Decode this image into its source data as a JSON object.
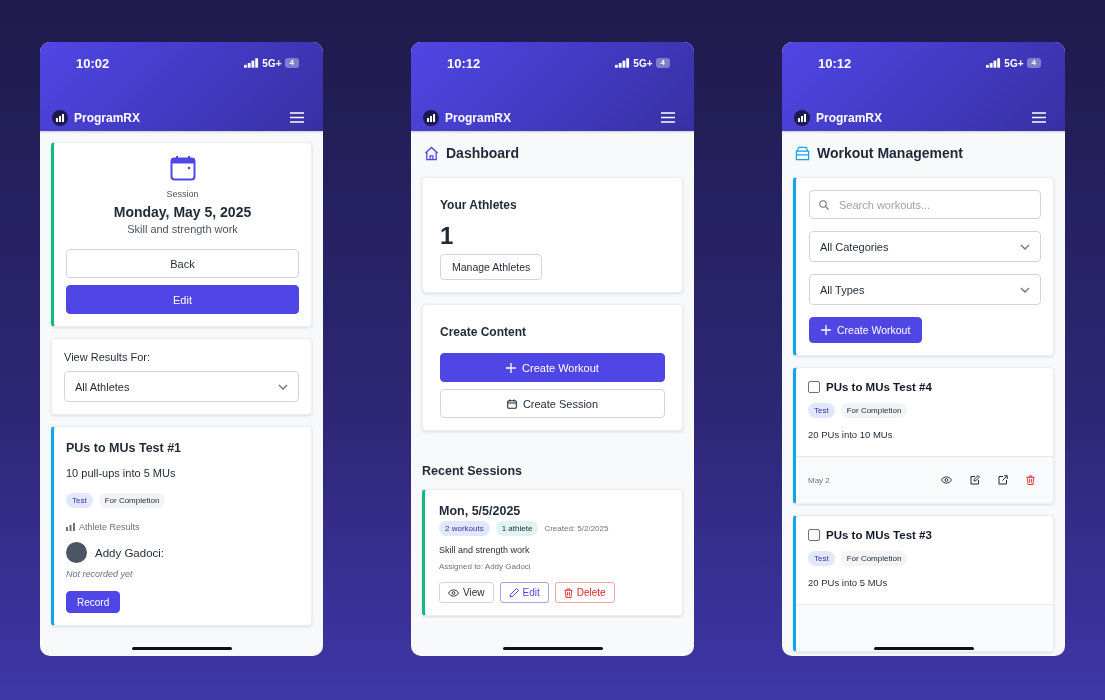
{
  "phones": [
    {
      "kind": "session_detail",
      "status": {
        "time": "10:02",
        "network": "5G+",
        "battery": "4"
      },
      "app": {
        "name": "ProgramRX"
      },
      "session": {
        "label": "Session",
        "date": "Monday, May 5, 2025",
        "description": "Skill and strength work",
        "buttons": [
          {
            "label": "Back",
            "kind": "secondary"
          },
          {
            "label": "Edit",
            "kind": "primary"
          }
        ]
      },
      "filter": {
        "label": "View Results For:",
        "value": "All Athletes"
      },
      "workout": {
        "title": "PUs to MUs Test #1",
        "description": "10 pull-ups into 5 MUs",
        "tags": [
          {
            "label": "Test",
            "kind": "type"
          },
          {
            "label": "For Completion",
            "kind": "scoring"
          }
        ],
        "results_heading": "Athlete Results",
        "athletes": [
          {
            "name": "Addy Gadoci:",
            "result": "Not recorded yet",
            "button": "Record"
          }
        ]
      }
    },
    {
      "kind": "dashboard",
      "status": {
        "time": "10:12",
        "network": "5G+",
        "battery": "4"
      },
      "app": {
        "name": "ProgramRX"
      },
      "title": "Dashboard",
      "athletes_card": {
        "title": "Your Athletes",
        "count": "1",
        "button": "Manage Athletes"
      },
      "create_card": {
        "title": "Create Content",
        "buttons": [
          {
            "label": "Create Workout",
            "kind": "primary"
          },
          {
            "label": "Create Session",
            "kind": "secondary"
          }
        ]
      },
      "recent": {
        "title": "Recent Sessions",
        "sessions": [
          {
            "date": "Mon, 5/5/2025",
            "badges": [
              {
                "label": "2 workouts",
                "kind": "workouts"
              },
              {
                "label": "1 athlete",
                "kind": "athletes"
              }
            ],
            "created": "Created: 5/2/2025",
            "description": "Skill and strength work",
            "assigned": "Assigned to: Addy Gadoci",
            "actions": [
              {
                "label": "View",
                "kind": "view"
              },
              {
                "label": "Edit",
                "kind": "edit"
              },
              {
                "label": "Delete",
                "kind": "delete"
              }
            ]
          }
        ]
      }
    },
    {
      "kind": "workouts",
      "status": {
        "time": "10:12",
        "network": "5G+",
        "battery": "4"
      },
      "app": {
        "name": "ProgramRX"
      },
      "title": "Workout Management",
      "search": {
        "placeholder": "Search workouts..."
      },
      "filters": [
        {
          "value": "All Categories"
        },
        {
          "value": "All Types"
        }
      ],
      "create_button": "Create Workout",
      "workouts": [
        {
          "title": "PUs to MUs Test #4",
          "checked": false,
          "tags": [
            {
              "label": "Test",
              "kind": "type"
            },
            {
              "label": "For Completion",
              "kind": "scoring"
            }
          ],
          "description": "20 PUs into 10 MUs",
          "date": "May 2"
        },
        {
          "title": "PUs to MUs Test #3",
          "checked": false,
          "tags": [
            {
              "label": "Test",
              "kind": "type"
            },
            {
              "label": "For Completion",
              "kind": "scoring"
            }
          ],
          "description": "20 PUs into 5 MUs"
        }
      ]
    }
  ]
}
